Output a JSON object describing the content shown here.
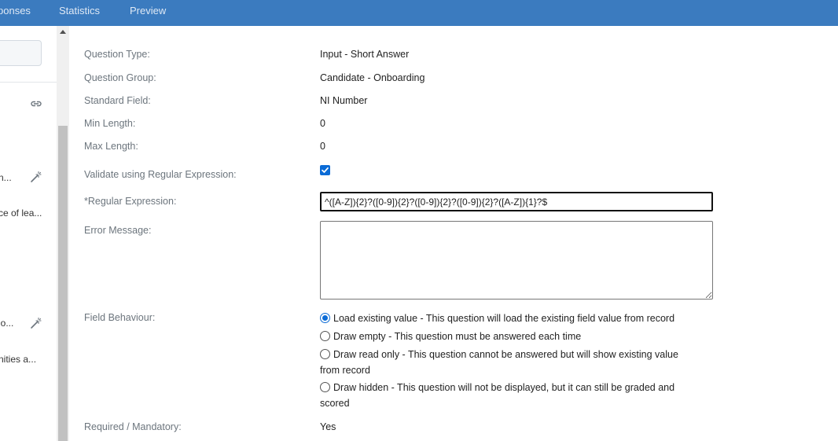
{
  "tabs": [
    "ponses",
    "Statistics",
    "Preview"
  ],
  "left_panel": {
    "items": [
      {
        "text": "n...",
        "icon": "magic-wand-icon"
      },
      {
        "text": "ce of lea..."
      },
      {
        "text": "io...",
        "icon": "magic-wand-icon"
      },
      {
        "text": "nities a..."
      }
    ],
    "link_icon": "link-icon"
  },
  "form": {
    "question_type": {
      "label": "Question Type:",
      "value": "Input - Short Answer"
    },
    "question_group": {
      "label": "Question Group:",
      "value": "Candidate - Onboarding"
    },
    "standard_field": {
      "label": "Standard Field:",
      "value": "NI Number"
    },
    "min_length": {
      "label": "Min Length:",
      "value": "0"
    },
    "max_length": {
      "label": "Max Length:",
      "value": "0"
    },
    "validate_regex": {
      "label": "Validate using Regular Expression:",
      "checked": true
    },
    "regular_expression": {
      "label": "*Regular Expression:",
      "value": "^([A-Z]){2}?([0-9]){2}?([0-9]){2}?([0-9]){2}?([A-Z]){1}?$"
    },
    "error_message": {
      "label": "Error Message:",
      "value": ""
    },
    "field_behaviour": {
      "label": "Field Behaviour:",
      "options": [
        {
          "label": "Load existing value - This question will load the existing field value from record",
          "checked": true
        },
        {
          "label": "Draw empty - This question must be answered each time",
          "checked": false
        },
        {
          "label": "Draw read only - This question cannot be answered but will show existing value from record",
          "checked": false
        },
        {
          "label": "Draw hidden - This question will not be displayed, but it can still be graded and scored",
          "checked": false
        }
      ]
    },
    "required": {
      "label": "Required / Mandatory:",
      "value": "Yes"
    }
  },
  "colors": {
    "header": "#3b7bbf",
    "accent": "#0b6bd6"
  }
}
